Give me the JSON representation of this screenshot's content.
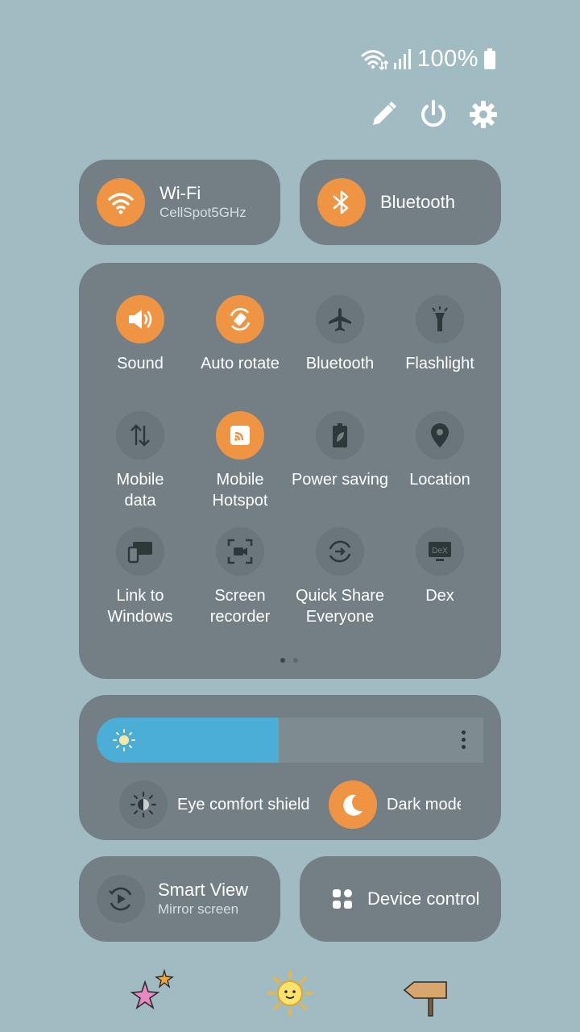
{
  "status_bar": {
    "battery_text": "100%"
  },
  "tiles": {
    "wifi": {
      "title": "Wi-Fi",
      "subtitle": "CellSpot5GHz"
    },
    "bluetooth": {
      "title": "Bluetooth"
    }
  },
  "quick_settings": [
    {
      "label": "Sound",
      "active": true
    },
    {
      "label": "Auto rotate",
      "active": true
    },
    {
      "label": "Bluetooth",
      "active": false
    },
    {
      "label": "Flashlight",
      "active": false
    },
    {
      "label": "Mobile\ndata",
      "active": false
    },
    {
      "label": "Mobile\nHotspot",
      "active": true
    },
    {
      "label": "Power saving",
      "active": false
    },
    {
      "label": "Location",
      "active": false
    },
    {
      "label": "Link to\nWindows",
      "active": false
    },
    {
      "label": "Screen\nrecorder",
      "active": false
    },
    {
      "label": "Quick Share\nEveryone",
      "active": false
    },
    {
      "label": "Dex",
      "active": false
    }
  ],
  "brightness": {
    "level_percent": 47
  },
  "toggles": {
    "eye_comfort": "Eye comfort shield",
    "dark_mode": "Dark mode"
  },
  "bottom_tiles": {
    "smart_view": {
      "title": "Smart View",
      "subtitle": "Mirror screen"
    },
    "device_control": {
      "title": "Device control"
    }
  },
  "colors": {
    "accent": "#ef9442",
    "tile_bg": "#737f84",
    "background": "#a0bbc2",
    "slider_fill": "#4aaed6"
  },
  "page_indicator": {
    "pages": 2,
    "current": 1
  }
}
